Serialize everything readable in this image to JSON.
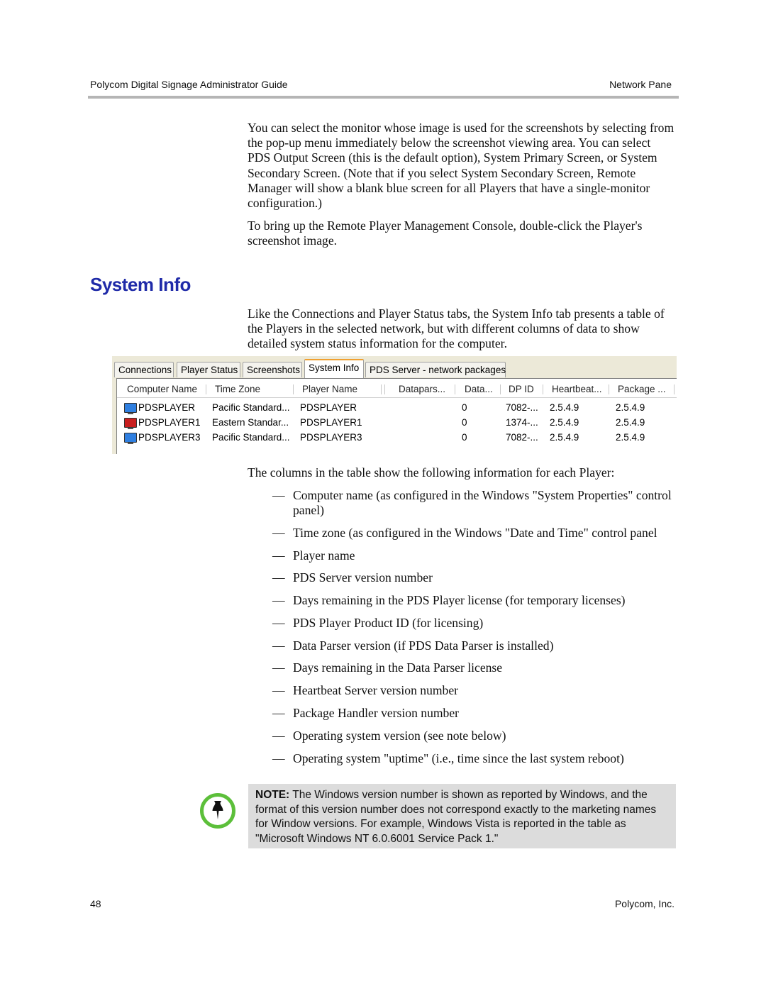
{
  "header": {
    "left": "Polycom Digital Signage Administrator Guide",
    "right": "Network Pane"
  },
  "intro": [
    "You can select the monitor whose image is used for the screenshots by selecting from the pop-up menu immediately below the screenshot viewing area. You can select PDS Output Screen (this is the default option), System Primary Screen, or System Secondary Screen. (Note that if you select System Secondary Screen, Remote Manager will show a blank blue screen for all Players that have a single-monitor configuration.)",
    "To bring up the Remote Player Management Console, double-click the Player's screenshot image."
  ],
  "section_title": "System Info",
  "section_intro": "Like the Connections and Player Status tabs, the System Info tab presents a table of the Players in the selected network, but with different columns of data to show detailed system status information for the computer.",
  "screenshot": {
    "tabs": [
      "Connections",
      "Player Status",
      "Screenshots",
      "System Info",
      "PDS Server - network packages"
    ],
    "active_tab": "System Info",
    "columns": [
      "Computer Name",
      "Time Zone",
      "Player Name",
      "Datapars...",
      "Data...",
      "DP ID",
      "Heartbeat...",
      "Package ..."
    ],
    "rows": [
      {
        "status_color": "#2f7fe0",
        "cells": [
          "PDSPLAYER",
          "Pacific Standard...",
          "PDSPLAYER",
          "",
          "0",
          "7082-...",
          "2.5.4.9",
          "2.5.4.9"
        ]
      },
      {
        "status_color": "#c81e1e",
        "cells": [
          "PDSPLAYER1",
          "Eastern Standar...",
          "PDSPLAYER1",
          "",
          "0",
          "1374-...",
          "2.5.4.9",
          "2.5.4.9"
        ]
      },
      {
        "status_color": "#2f7fe0",
        "cells": [
          "PDSPLAYER3",
          "Pacific Standard...",
          "PDSPLAYER3",
          "",
          "0",
          "7082-...",
          "2.5.4.9",
          "2.5.4.9"
        ]
      }
    ]
  },
  "columns_intro": "The columns in the table show the following information for each Player:",
  "bullet_dash": "—",
  "bullets": [
    "Computer name (as configured in the Windows \"System Properties\" control panel)",
    "Time zone (as configured in the Windows \"Date and Time\" control panel",
    "Player name",
    "PDS Server version number",
    "Days remaining in the PDS Player license (for temporary licenses)",
    "PDS Player Product ID (for licensing)",
    "Data Parser version (if PDS Data Parser is installed)",
    "Days remaining in the Data Parser license",
    "Heartbeat Server version number",
    "Package Handler version number",
    "Operating system version (see note below)",
    "Operating system \"uptime\" (i.e., time since the last system reboot)"
  ],
  "note": {
    "label": "NOTE:",
    "text": " The Windows version number is shown as reported by Windows, and the format of this version number does not correspond exactly to the marketing names for Window versions. For example, Windows Vista is reported in the table as \"Microsoft Windows NT 6.0.6001 Service Pack 1.\"",
    "icon": "pushpin-icon",
    "icon_color": "#5cbf3a"
  },
  "footer": {
    "page": "48",
    "company": "Polycom, Inc."
  },
  "colors": {
    "heading": "#1f2aa8",
    "note_bg": "#dcdcdc"
  }
}
